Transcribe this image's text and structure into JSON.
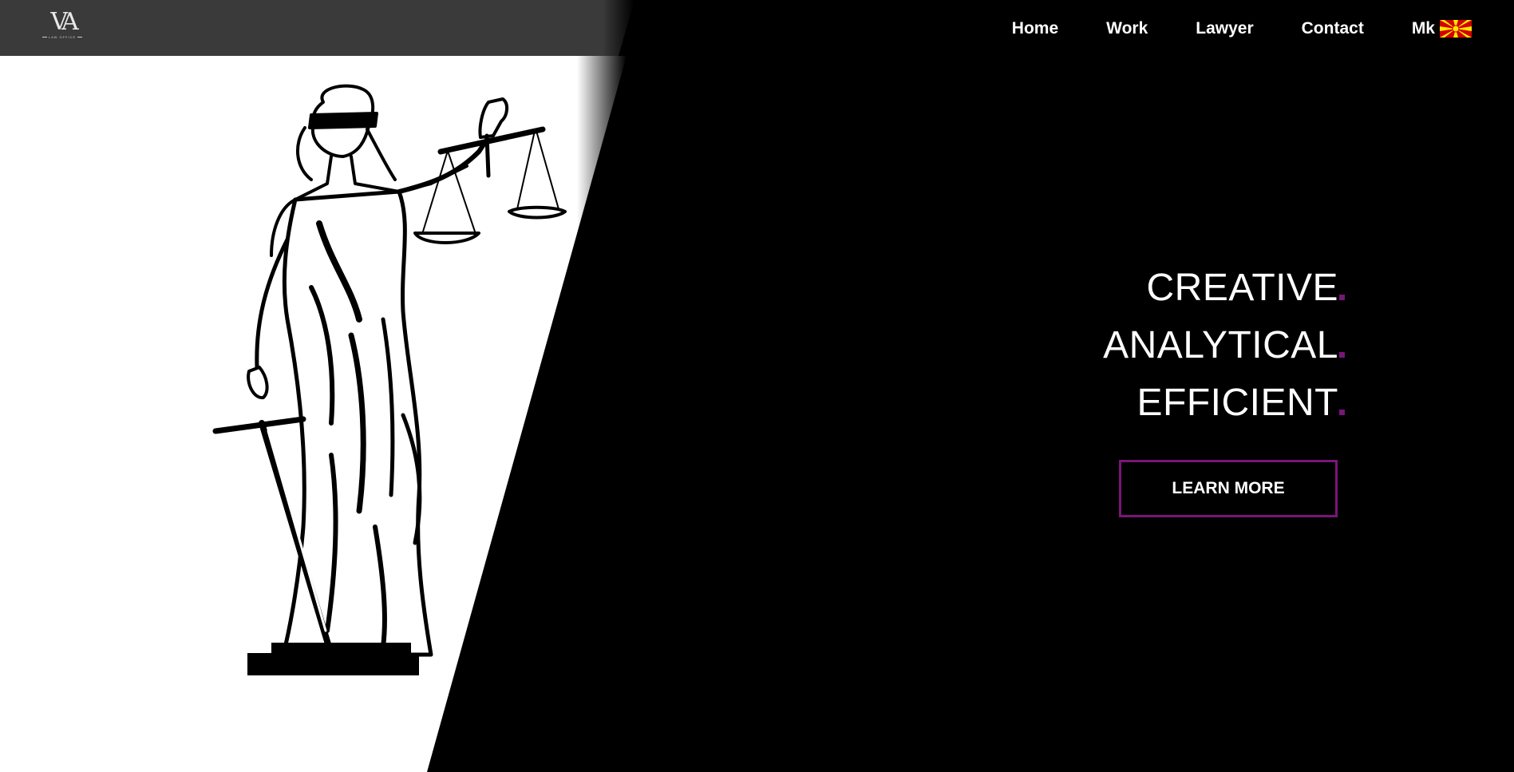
{
  "nav": {
    "logo_text": "VA",
    "logo_subtext": "LAW OFFICE",
    "links": [
      {
        "label": "Home"
      },
      {
        "label": "Work"
      },
      {
        "label": "Lawyer"
      },
      {
        "label": "Contact"
      }
    ],
    "language": {
      "label": "Mk",
      "flag_icon": "macedonia-flag-icon"
    }
  },
  "hero": {
    "taglines": [
      "CREATIVE",
      "ANALYTICAL",
      "EFFICIENT"
    ],
    "cta_label": "LEARN MORE",
    "illustration": "lady-justice-statue-icon"
  },
  "colors": {
    "background": "#000000",
    "navbar": "#3a3a3a",
    "accent": "#7a1577",
    "text": "#ffffff",
    "light_panel": "#ffffff"
  }
}
